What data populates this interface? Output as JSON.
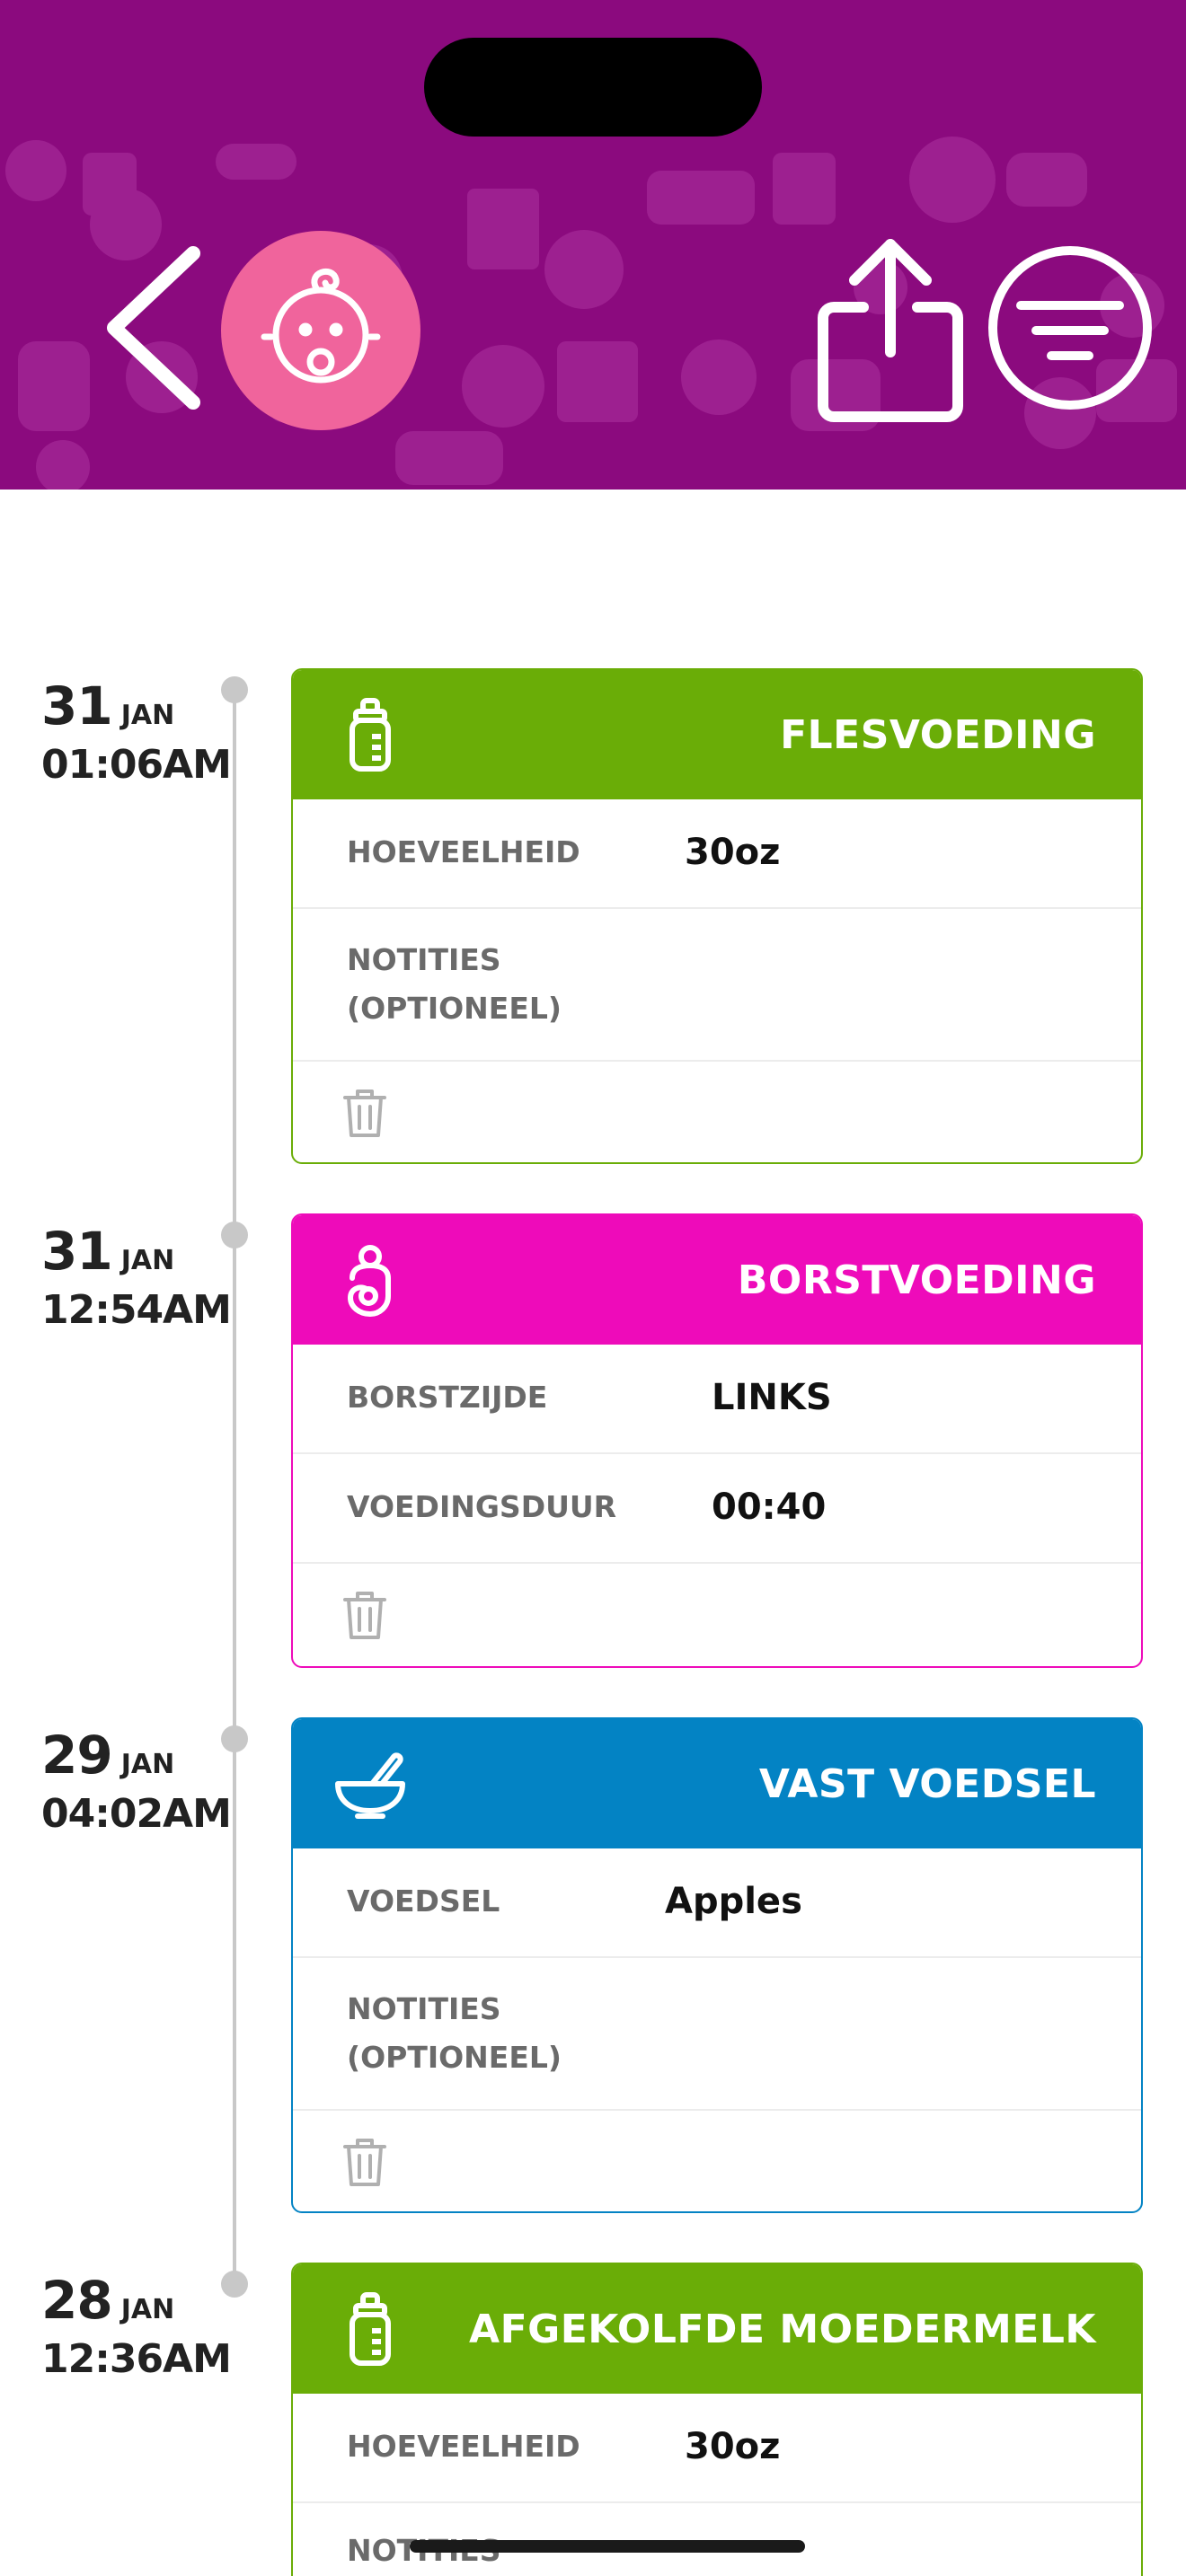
{
  "colors": {
    "header": "#8b0a7e",
    "avatar": "#f0649c",
    "bottle": "#6aad07",
    "breast": "#ee0bba",
    "solid": "#0383c4"
  },
  "header": {
    "back_icon": "chevron-left-icon",
    "avatar_icon": "baby-face-icon",
    "share_icon": "share-icon",
    "filter_icon": "filter-icon"
  },
  "entries": [
    {
      "day": "31",
      "month": "JAN",
      "time": "01:06AM",
      "title": "FLESVOEDING",
      "icon": "bottle-icon",
      "fields": [
        {
          "label": "HOEVEELHEID",
          "value": "30oz"
        },
        {
          "label_1": "NOTITIES",
          "label_2": "(OPTIONEEL)",
          "value": ""
        }
      ]
    },
    {
      "day": "31",
      "month": "JAN",
      "time": "12:54AM",
      "title": "BORSTVOEDING",
      "icon": "breastfeeding-icon",
      "fields": [
        {
          "label": "BORSTZIJDE",
          "value": "LINKS"
        },
        {
          "label": "VOEDINGSDUUR",
          "value": "00:40"
        }
      ]
    },
    {
      "day": "29",
      "month": "JAN",
      "time": "04:02AM",
      "title": "VAST VOEDSEL",
      "icon": "mortar-pestle-icon",
      "fields": [
        {
          "label": "VOEDSEL",
          "value": "Apples"
        },
        {
          "label_1": "NOTITIES",
          "label_2": "(OPTIONEEL)",
          "value": ""
        }
      ]
    },
    {
      "day": "28",
      "month": "JAN",
      "time": "12:36AM",
      "title": "AFGEKOLFDE MOEDERMELK",
      "icon": "bottle-icon",
      "fields": [
        {
          "label": "HOEVEELHEID",
          "value": "30oz"
        },
        {
          "label_1": "NOTITIES",
          "label_2": "",
          "value": ""
        }
      ]
    }
  ]
}
